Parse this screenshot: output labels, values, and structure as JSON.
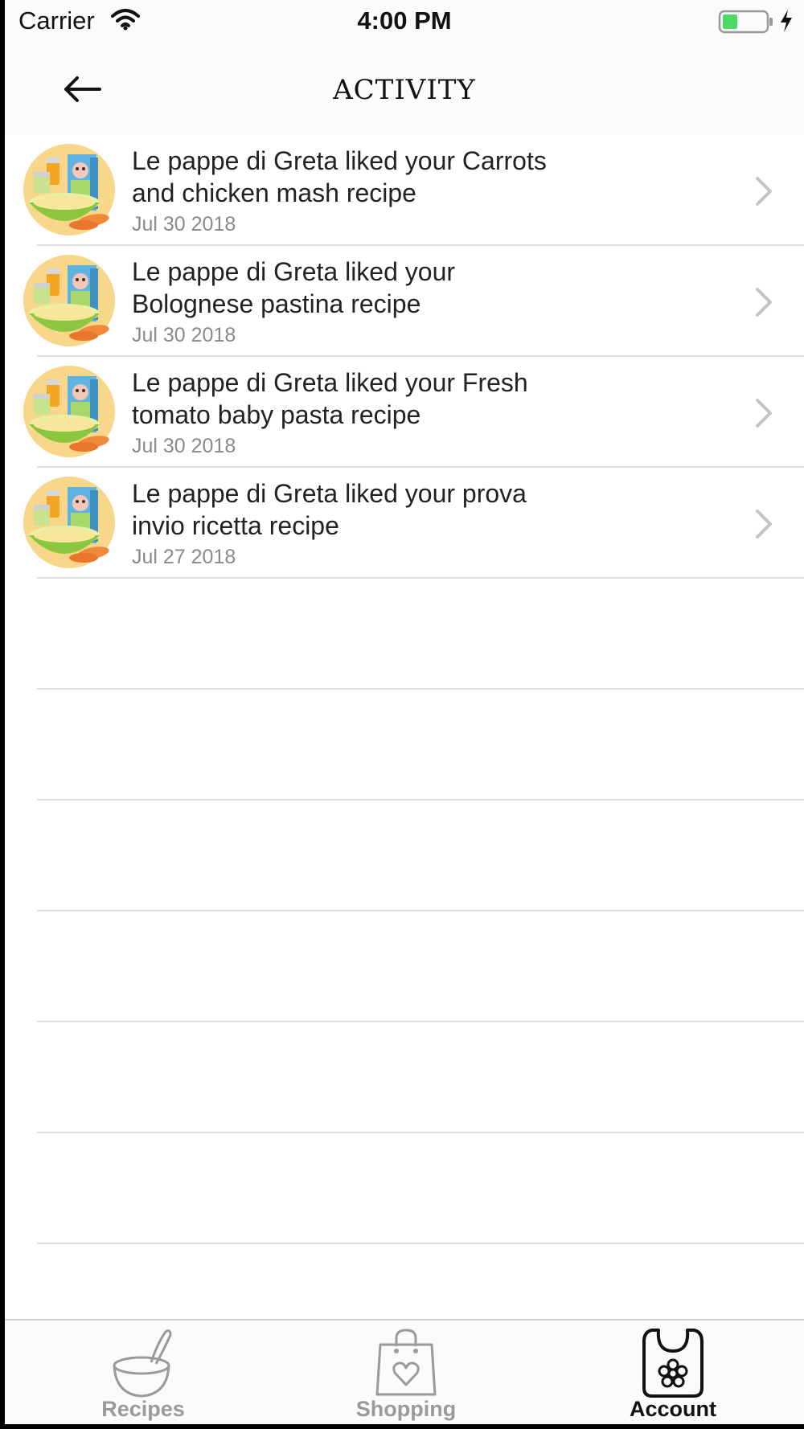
{
  "status_bar": {
    "carrier": "Carrier",
    "time": "4:00 PM",
    "wifi_icon": "wifi-icon",
    "battery_icon": "battery-charging-icon",
    "battery_color": "#4cd964"
  },
  "nav": {
    "back_icon": "arrow-left-icon",
    "title": "ACTIVITY"
  },
  "activity": [
    {
      "avatar_icon": "baby-food-avatar",
      "message": "Le pappe di Greta liked your Carrots and chicken mash recipe",
      "date": "Jul 30 2018"
    },
    {
      "avatar_icon": "baby-food-avatar",
      "message": "Le pappe di Greta liked your Bolognese pastina recipe",
      "date": "Jul 30 2018"
    },
    {
      "avatar_icon": "baby-food-avatar",
      "message": "Le pappe di Greta liked your Fresh tomato baby pasta recipe",
      "date": "Jul 30 2018"
    },
    {
      "avatar_icon": "baby-food-avatar",
      "message": "Le pappe di Greta liked your prova invio ricetta recipe",
      "date": "Jul 27 2018"
    }
  ],
  "tabs": [
    {
      "label": "Recipes",
      "icon": "bowl-spoon-icon",
      "active": false
    },
    {
      "label": "Shopping",
      "icon": "shopping-bag-heart-icon",
      "active": false
    },
    {
      "label": "Account",
      "icon": "bib-flower-icon",
      "active": true
    }
  ],
  "colors": {
    "accent_active": "#111111",
    "tab_inactive": "#9a9a9a",
    "separator": "#dcdcdc",
    "avatar_bg": "#f8d68a"
  }
}
